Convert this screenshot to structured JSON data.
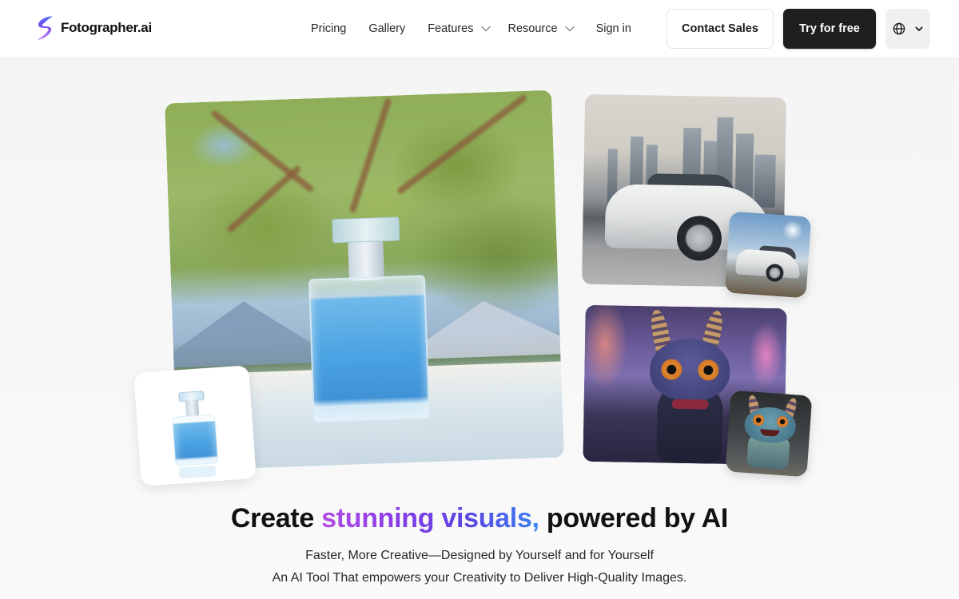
{
  "header": {
    "brand": "Fotographer.ai",
    "logo_icon": "lightning-bolt-icon",
    "nav": [
      {
        "label": "Pricing",
        "has_dropdown": false
      },
      {
        "label": "Gallery",
        "has_dropdown": false
      },
      {
        "label": "Features",
        "has_dropdown": true
      },
      {
        "label": "Resource",
        "has_dropdown": true
      },
      {
        "label": "Sign in",
        "has_dropdown": false
      }
    ],
    "contact_label": "Contact Sales",
    "try_label": "Try for free",
    "language_icon": "globe-icon"
  },
  "gallery": {
    "main_image": "perfume-bottle-mountain-scene",
    "main_thumb": "perfume-bottle-product-shot",
    "car_image": "white-suv-city-skyline",
    "car_thumb": "white-suv-beach",
    "monster_image": "monster-character-neon-street",
    "monster_thumb": "monster-character-figurine"
  },
  "hero": {
    "title_before": "Create ",
    "title_highlight": "stunning visuals,",
    "title_after": " powered by AI",
    "gradient_colors": [
      "#b44de6",
      "#8a3ce8",
      "#5a45e0",
      "#3b82f6"
    ],
    "subtitle_1": "Faster, More Creative—Designed by Yourself and for Yourself",
    "subtitle_2": "An AI Tool That empowers your Creativity to Deliver High-Quality Images."
  }
}
